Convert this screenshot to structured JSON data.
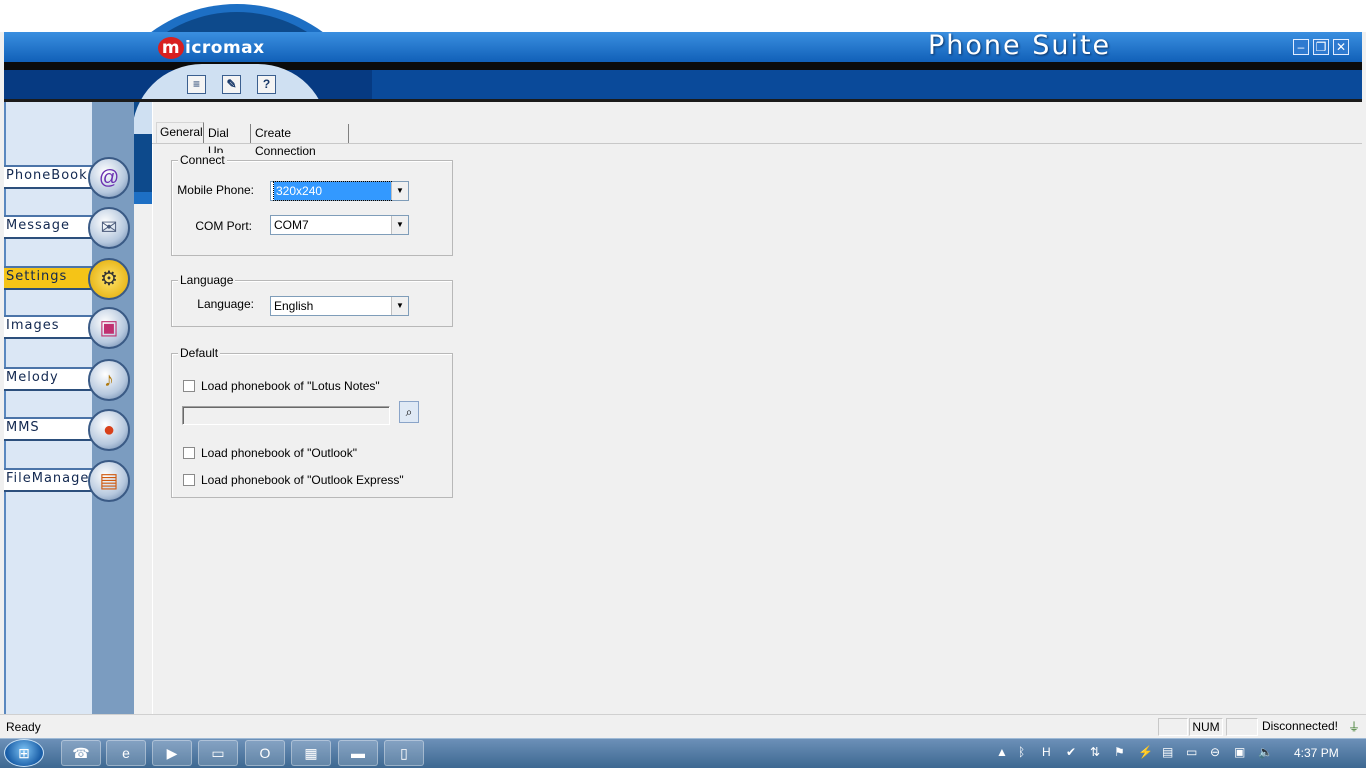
{
  "app": {
    "logo_text": "icromax",
    "logo_mark": "m",
    "title": "Phone Suite"
  },
  "window_buttons": [
    {
      "name": "minimize",
      "glyph": "–"
    },
    {
      "name": "restore",
      "glyph": "❐"
    },
    {
      "name": "close",
      "glyph": "✕"
    }
  ],
  "toolbar": [
    {
      "name": "notes",
      "glyph": "≡"
    },
    {
      "name": "edit",
      "glyph": "✎"
    },
    {
      "name": "help",
      "glyph": "?"
    }
  ],
  "nav": [
    {
      "label": "PhoneBook",
      "icon": "phone-icon",
      "glyph": "@"
    },
    {
      "label": "Message",
      "icon": "envelope-icon",
      "glyph": "✉"
    },
    {
      "label": "Settings",
      "icon": "tools-icon",
      "glyph": "⚙",
      "active": true
    },
    {
      "label": "Images",
      "icon": "picture-icon",
      "glyph": "▣"
    },
    {
      "label": "Melody",
      "icon": "music-icon",
      "glyph": "♪"
    },
    {
      "label": "MMS",
      "icon": "balloon-icon",
      "glyph": "●"
    },
    {
      "label": "FileManager",
      "icon": "folder-icon",
      "glyph": "▤"
    }
  ],
  "tabs": [
    {
      "label": "General",
      "active": true
    },
    {
      "label": "Dial Up"
    },
    {
      "label": "Create Connection"
    }
  ],
  "connect": {
    "legend": "Connect",
    "mobile_label": "Mobile Phone:",
    "mobile_value": "320x240",
    "com_label": "COM Port:",
    "com_value": "COM7"
  },
  "language": {
    "legend": "Language",
    "label": "Language:",
    "value": "English"
  },
  "default": {
    "legend": "Default",
    "lotus": "Load phonebook of \"Lotus Notes\"",
    "path_value": "",
    "outlook": "Load phonebook of \"Outlook\"",
    "outlook_express": "Load phonebook of \"Outlook Express\""
  },
  "status": {
    "ready": "Ready",
    "num": "NUM",
    "connection": "Disconnected!"
  },
  "taskbar": {
    "apps": [
      {
        "name": "phone-suite-app",
        "glyph": "☎"
      },
      {
        "name": "internet-explorer-app",
        "glyph": "e"
      },
      {
        "name": "media-player-app",
        "glyph": "▶"
      },
      {
        "name": "explorer-app",
        "glyph": "▭"
      },
      {
        "name": "opera-app",
        "glyph": "O"
      },
      {
        "name": "network-app",
        "glyph": "▦"
      },
      {
        "name": "toolbox-app",
        "glyph": "▬"
      },
      {
        "name": "notepad-app",
        "glyph": "▯"
      }
    ],
    "clock": "4:37 PM"
  }
}
